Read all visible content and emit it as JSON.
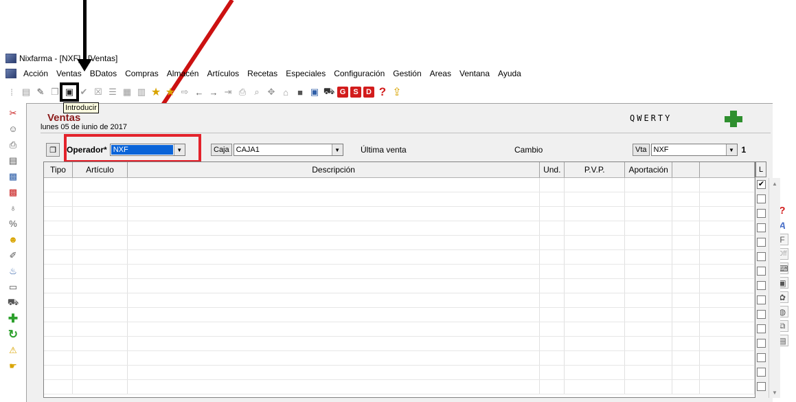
{
  "window": {
    "title": "Nixfarma - [NXF] - [Ventas]"
  },
  "menu": [
    "Acción",
    "Ventas",
    "BDatos",
    "Compras",
    "Almacén",
    "Artículos",
    "Recetas",
    "Especiales",
    "Configuración",
    "Gestión",
    "Areas",
    "Ventana",
    "Ayuda"
  ],
  "toolbar": {
    "icons": [
      "grip-icon",
      "note-icon",
      "edit-icon",
      "copy-icon",
      "introducir-icon",
      "check-icon",
      "cancel-icon",
      "list-icon",
      "list2-icon",
      "chart-icon",
      "star-icon",
      "star2-icon",
      "export-icon",
      "prev-icon",
      "next-icon",
      "import-icon",
      "print-icon",
      "search-icon",
      "pin-icon",
      "home-icon",
      "stop-icon",
      "monitor-icon",
      "cart-icon",
      "g-icon",
      "s-icon",
      "d-icon",
      "help-icon",
      "upload-icon"
    ],
    "g_label": "G",
    "s_label": "S",
    "d_label": "D",
    "help_label": "?",
    "tooltip": "Introducir"
  },
  "panel": {
    "title": "Ventas",
    "date": "lunes 05 de iunio de 2017",
    "brand": "QWERTY"
  },
  "controls": {
    "operador_label": "Operador*",
    "operador_value": "NXF",
    "caja_label": "Caja",
    "caja_value": "CAJA1",
    "ultima_venta_label": "Última venta",
    "cambio_label": "Cambio",
    "vta_label": "Vta",
    "vta_value": "NXF",
    "count": "1"
  },
  "grid": {
    "columns": [
      "Tipo",
      "Artículo",
      "Descripción",
      "Und.",
      "P.V.P.",
      "Aportación",
      ""
    ],
    "l_header": "L",
    "rows": 15,
    "first_checked": true
  },
  "colors": {
    "annotation_red": "#e3222b",
    "title_red": "#8b1a1a",
    "selection_blue": "#0a64d8",
    "cross_green": "#2f8f2f"
  }
}
